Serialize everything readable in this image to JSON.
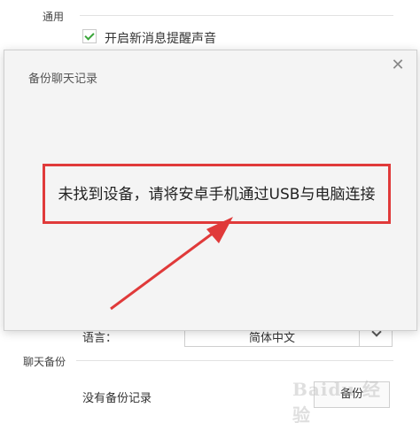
{
  "settings": {
    "general_section": "通用",
    "sound_option": {
      "label": "开启新消息提醒声音",
      "checked": true
    },
    "language": {
      "label": "语言：",
      "value": "简体中文"
    },
    "backup_section": "聊天备份",
    "no_backup": "没有备份记录",
    "backup_button": "备份"
  },
  "dialog": {
    "title": "备份聊天记录",
    "close_icon": "close-icon",
    "message": "未找到设备，请将安卓手机通过USB与电脑连接"
  },
  "annotation": {
    "box_color": "#e03a3a",
    "arrow_color": "#e03a3a"
  },
  "watermark": "Baidu 经验",
  "colors": {
    "check": "#3aa53a",
    "dialog_bg": "#f4f4f4"
  }
}
